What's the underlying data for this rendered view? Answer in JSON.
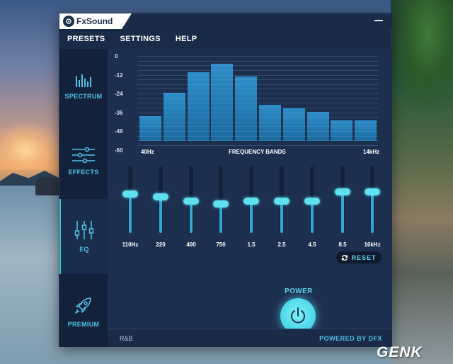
{
  "app": {
    "title": "FxSound"
  },
  "menu": [
    "PRESETS",
    "SETTINGS",
    "HELP"
  ],
  "sidebar": [
    {
      "label": "SPECTRUM",
      "icon": "spectrum-icon",
      "active": false
    },
    {
      "label": "EFFECTS",
      "icon": "sliders-icon",
      "active": false
    },
    {
      "label": "EQ",
      "icon": "eq-icon",
      "active": true
    },
    {
      "label": "PREMIUM",
      "icon": "rocket-icon",
      "active": false
    }
  ],
  "spectrum": {
    "db_levels": [
      "0",
      "-12",
      "-24",
      "-36",
      "-48",
      "-60"
    ],
    "x_start": "40Hz",
    "x_title": "FREQUENCY BANDS",
    "x_end": "14kHz",
    "bar_levels": [
      0.28,
      0.55,
      0.78,
      0.88,
      0.73,
      0.41,
      0.37,
      0.33,
      0.23,
      0.23
    ]
  },
  "eq": {
    "bands": [
      "110Hz",
      "220",
      "400",
      "750",
      "1.5",
      "2.5",
      "4.5",
      "8.5",
      "16kHz"
    ],
    "levels": [
      0.58,
      0.54,
      0.48,
      0.44,
      0.48,
      0.48,
      0.48,
      0.62,
      0.62
    ]
  },
  "power": {
    "label": "POWER",
    "on": true
  },
  "reset": {
    "label": "RESET"
  },
  "footer": {
    "preset_name": "R&B",
    "powered_by": "POWERED BY DFX"
  },
  "watermark": "GENK",
  "colors": {
    "accent": "#5ed3e8",
    "background": "#1c2f4f",
    "bar": "#2e8ec8"
  }
}
